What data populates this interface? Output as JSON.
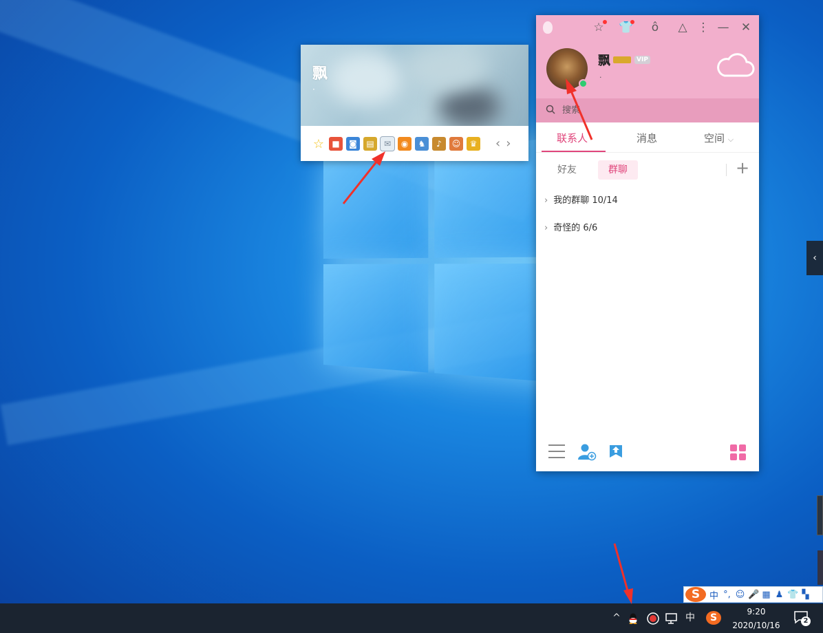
{
  "popup": {
    "name": "飘",
    "subtitle": "·",
    "apps": [
      {
        "icon": "star-icon",
        "glyph": "☆",
        "color": "#f4c21b"
      },
      {
        "icon": "gift-app-icon",
        "glyph": "■",
        "color": "#e8533a"
      },
      {
        "icon": "camera-app-icon",
        "glyph": "◙",
        "color": "#3c86d8"
      },
      {
        "icon": "document-app-icon",
        "glyph": "▤",
        "color": "#d6a82c"
      },
      {
        "icon": "mail-icon",
        "glyph": "✉",
        "color": "#e6eef4"
      },
      {
        "icon": "orange-circle-icon",
        "glyph": "◉",
        "color": "#f28a1e"
      },
      {
        "icon": "game-app-icon",
        "glyph": "♞",
        "color": "#4a8fd6"
      },
      {
        "icon": "music-app-icon",
        "glyph": "♪",
        "color": "#c88a2e"
      },
      {
        "icon": "character-app-icon",
        "glyph": "☺",
        "color": "#e07a3c"
      },
      {
        "icon": "hero-app-icon",
        "glyph": "♛",
        "color": "#e8b020"
      }
    ],
    "prev_glyph": "‹",
    "next_glyph": "›"
  },
  "panel": {
    "nickname": "飘",
    "vip_label": "VIP",
    "signature": "·",
    "search_placeholder": "搜索",
    "tabs": [
      "联系人",
      "消息",
      "空间"
    ],
    "tab_dropdown_glyph": "⌵",
    "subtabs": [
      "好友",
      "群聊"
    ],
    "plus_glyph": "+",
    "groups": [
      {
        "name": "我的群聊",
        "count": "10/14"
      },
      {
        "name": "奇怪的",
        "count": "6/6"
      }
    ],
    "chevron_glyph": "›"
  },
  "side_handle_glyph": "‹",
  "ime": {
    "logo": "S",
    "items": [
      "中",
      "°,",
      "☺",
      "🎤",
      "▦",
      "♟",
      "👕",
      "▚"
    ]
  },
  "taskbar": {
    "tray_up": "^",
    "ime_lang": "中",
    "time": "9:20",
    "date": "2020/10/16",
    "notification_count": "2"
  },
  "colors": {
    "accent": "#e0457b",
    "panel_header": "#f2afcc",
    "taskbar": "#1b2430",
    "online": "#2ecc71"
  }
}
